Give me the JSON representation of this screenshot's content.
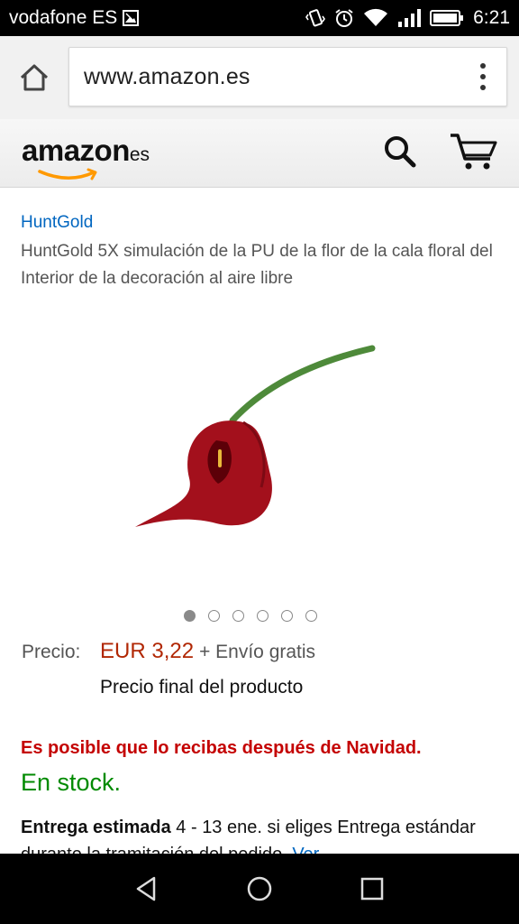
{
  "status_bar": {
    "carrier": "vodafone ES",
    "time": "6:21"
  },
  "browser": {
    "url": "www.amazon.es"
  },
  "amazon_header": {
    "logo_main": "amazon",
    "logo_tld": "es"
  },
  "product": {
    "brand": "HuntGold",
    "title": "HuntGold 5X simulación de la PU de la flor de la cala floral del Interior de la decoración al aire libre",
    "image_count": 6,
    "active_image": 1,
    "price_label": "Precio:",
    "price": "EUR 3,22",
    "shipping": "+ Envío gratis",
    "price_note": "Precio final del producto",
    "delivery_warning": "Es posible que lo recibas después de Navidad.",
    "stock": "En stock.",
    "delivery_prefix": "Entrega estimada",
    "delivery_dates": " 4 - 13 ene.",
    "delivery_text": " si eliges Entrega estándar durante la tramitación del pedido.",
    "delivery_link": "Ver"
  },
  "colors": {
    "price": "#b12704",
    "stock": "#008a00",
    "warning": "#c40000",
    "link": "#0066c0"
  }
}
